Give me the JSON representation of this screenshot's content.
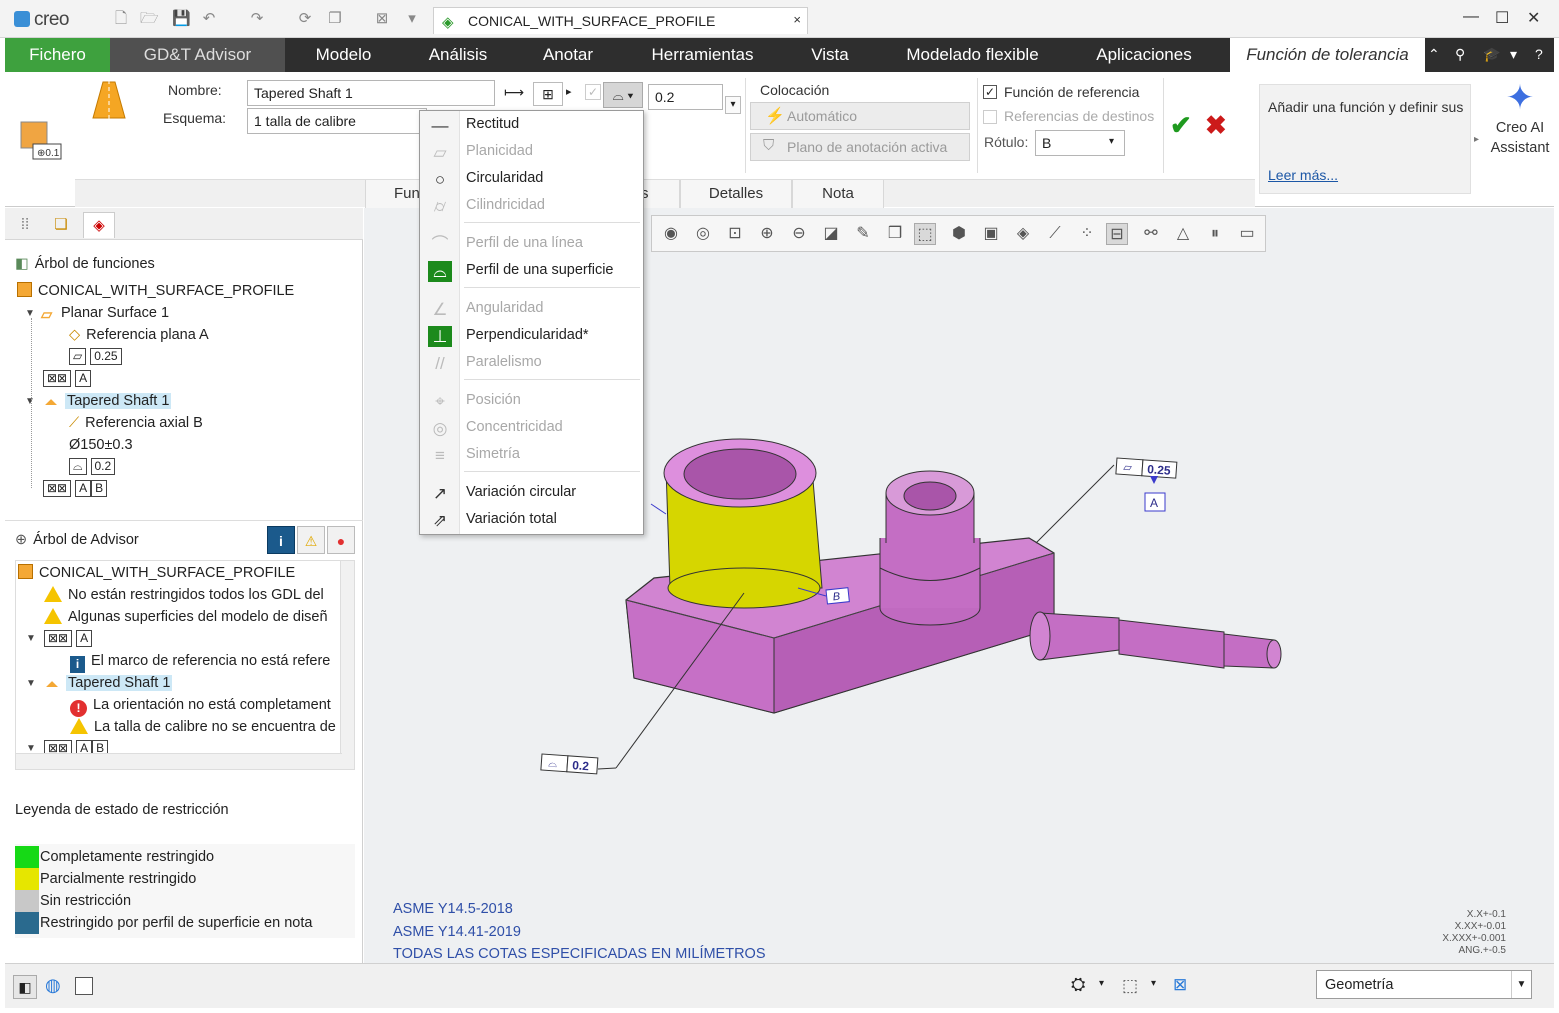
{
  "app": {
    "logo": "creo"
  },
  "doc_tab": {
    "title": "CONICAL_WITH_SURFACE_PROFILE",
    "close": "×"
  },
  "ribbon_tabs": [
    "Fichero",
    "GD&T Advisor",
    "Modelo",
    "Análisis",
    "Anotar",
    "Herramientas",
    "Vista",
    "Modelado flexible",
    "Aplicaciones",
    "Función de tolerancia"
  ],
  "ribbon": {
    "name_label": "Nombre:",
    "name_value": "Tapered Shaft 1",
    "scheme_label": "Esquema:",
    "scheme_value": "1 talla de calibre",
    "tolerance_value": "0.2",
    "placement_title": "Colocación",
    "auto_btn": "Automático",
    "plane_btn": "Plano de anotación activa",
    "ref_feature_label": "Función de referencia",
    "ref_targets_label": "Referencias de destinos",
    "label_label": "Rótulo:",
    "label_value": "B",
    "help_text": "Añadir una función y definir sus",
    "help_link": "Leer más...",
    "ai_assistant": "Creo AI Assistant",
    "subtabs": [
      "Func",
      "s",
      "Detalles",
      "Nota"
    ]
  },
  "dropdown": {
    "items": [
      {
        "label": "Rectitud",
        "icon": "straightness-icon",
        "sym": "—",
        "disabled": false
      },
      {
        "label": "Planicidad",
        "icon": "flatness-icon",
        "sym": "▱",
        "disabled": true
      },
      {
        "label": "Circularidad",
        "icon": "circularity-icon",
        "sym": "○",
        "disabled": false
      },
      {
        "label": "Cilindricidad",
        "icon": "cylindricity-icon",
        "sym": "⌭",
        "disabled": true
      },
      {
        "label": "Perfil de una línea",
        "icon": "line-profile-icon",
        "sym": "⌒",
        "disabled": true
      },
      {
        "label": "Perfil de una superficie",
        "icon": "surface-profile-icon",
        "sym": "⌓",
        "disabled": false
      },
      {
        "label": "Angularidad",
        "icon": "angularity-icon",
        "sym": "∠",
        "disabled": true
      },
      {
        "label": "Perpendicularidad*",
        "icon": "perpendicularity-icon",
        "sym": "⊥",
        "disabled": false
      },
      {
        "label": "Paralelismo",
        "icon": "parallelism-icon",
        "sym": "//",
        "disabled": true
      },
      {
        "label": "Posición",
        "icon": "position-icon",
        "sym": "⌖",
        "disabled": true
      },
      {
        "label": "Concentricidad",
        "icon": "concentricity-icon",
        "sym": "◎",
        "disabled": true
      },
      {
        "label": "Simetría",
        "icon": "symmetry-icon",
        "sym": "≡",
        "disabled": true
      },
      {
        "label": "Variación circular",
        "icon": "circular-runout-icon",
        "sym": "↗",
        "disabled": false
      },
      {
        "label": "Variación total",
        "icon": "total-runout-icon",
        "sym": "⇗",
        "disabled": false
      }
    ]
  },
  "feature_tree": {
    "title": "Árbol de funciones",
    "root": "CONICAL_WITH_SURFACE_PROFILE",
    "planar": "Planar Surface 1",
    "planar_ref": "Referencia plana A",
    "flatness_val": "0.25",
    "datum_a": "A",
    "tapered": "Tapered Shaft 1",
    "axis_ref": "Referencia axial B",
    "diameter": "Ø150±0.3",
    "profile_val": "0.2",
    "datum_b1": "A",
    "datum_b2": "B"
  },
  "advisor_tree": {
    "title": "Árbol de Advisor",
    "root": "CONICAL_WITH_SURFACE_PROFILE",
    "w1": "No están restringidos todos los GDL del",
    "w2": "Algunas superficies del modelo de diseñ",
    "datum_a": "A",
    "i1": "El marco de referencia no está refere",
    "tapered": "Tapered Shaft 1",
    "e1": "La orientación no está completament",
    "w3": "La talla de calibre no se encuentra de",
    "datum_b1": "A",
    "datum_b2": "B"
  },
  "legend": {
    "title": "Leyenda de estado de restricción",
    "items": [
      {
        "label": "Completamente restringido",
        "color": "#16d916"
      },
      {
        "label": "Parcialmente restringido",
        "color": "#e6e600"
      },
      {
        "label": "Sin restricción",
        "color": "#c8c8c8"
      },
      {
        "label": "Restringido por perfil de superficie en nota",
        "color": "#2a6a8e"
      }
    ]
  },
  "model": {
    "note1_sym": "▱",
    "note1_val": "0.25",
    "note1_datum": "A",
    "note2_sym": "⌓",
    "note2_val": "0.2",
    "datum_b": "B"
  },
  "notes": [
    "ASME Y14.5-2018",
    "ASME Y14.41-2019",
    "TODAS LAS COTAS ESPECIFICADAS EN MILÍMETROS"
  ],
  "tol_corner": [
    "X.X+-0.1",
    "X.XX+-0.01",
    "X.XXX+-0.001",
    "ANG.+-0.5"
  ],
  "status": {
    "filter": "Geometría"
  }
}
